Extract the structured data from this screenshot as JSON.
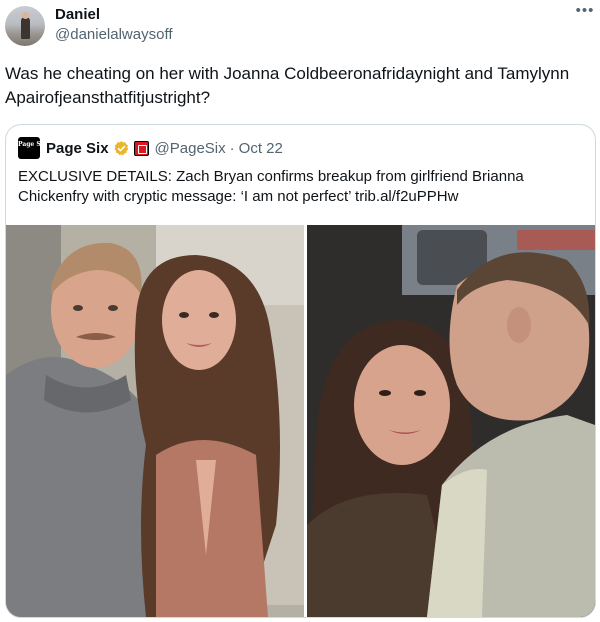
{
  "author": {
    "display_name": "Daniel",
    "handle": "@danielalwaysoff"
  },
  "more_icon": "more-horizontal-icon",
  "tweet_text": "Was he cheating on her with Joanna Coldbeeronafridaynight and Tamylynn Apairofjeansthatfitjustright?",
  "quote": {
    "logo_text": "Page Six",
    "name": "Page Six",
    "verified_icon": "gold-verified-icon",
    "affiliate_badge_icon": "affiliate-badge-icon",
    "handle": "@PageSix",
    "date": "Oct 22",
    "separator": "·",
    "text": "EXCLUSIVE DETAILS: Zach Bryan confirms breakup from girlfriend Brianna Chickenfry with cryptic message: ‘I am not perfect’ trib.al/f2uPPHw"
  },
  "media": {
    "left_photo": "couple-portrait-photo",
    "right_photo": "couple-kiss-selfie-photo"
  },
  "colors": {
    "text": "#0f1419",
    "secondary": "#536471",
    "border": "#cfd9de",
    "verified_gold": "#e8b72e"
  }
}
